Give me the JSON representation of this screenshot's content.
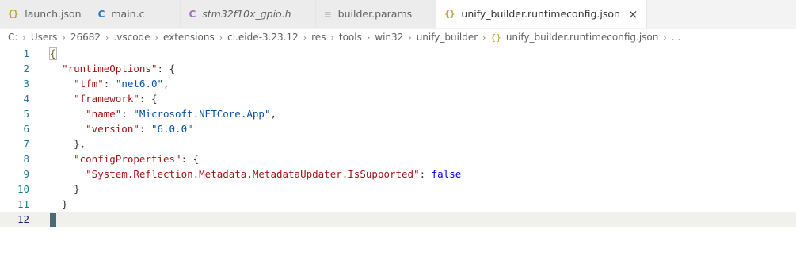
{
  "tabs": [
    {
      "icon": "{}",
      "label": "launch.json",
      "active": false,
      "italic": false
    },
    {
      "icon": "C",
      "label": "main.c",
      "active": false,
      "italic": false
    },
    {
      "icon": "C",
      "label": "stm32f10x_gpio.h",
      "active": false,
      "italic": true
    },
    {
      "icon": "≡",
      "label": "builder.params",
      "active": false,
      "italic": false
    },
    {
      "icon": "{}",
      "label": "unify_builder.runtimeconfig.json",
      "active": true,
      "italic": false,
      "close": "×"
    }
  ],
  "breadcrumb": [
    "C:",
    "Users",
    "26682",
    ".vscode",
    "extensions",
    "cl.eide-3.23.12",
    "res",
    "tools",
    "win32",
    "unify_builder"
  ],
  "breadcrumb_file": {
    "icon": "{}",
    "label": "unify_builder.runtimeconfig.json"
  },
  "breadcrumb_more": "...",
  "editor": {
    "line_numbers": [
      "1",
      "2",
      "3",
      "4",
      "5",
      "6",
      "7",
      "8",
      "9",
      "10",
      "11",
      "12"
    ],
    "lines": [
      "{",
      "  \"runtimeOptions\": {",
      "    \"tfm\": \"net6.0\",",
      "    \"framework\": {",
      "      \"name\": \"Microsoft.NETCore.App\",",
      "      \"version\": \"6.0.0\"",
      "    },",
      "    \"configProperties\": {",
      "      \"System.Reflection.Metadata.MetadataUpdater.IsSupported\": false",
      "    }",
      "  }",
      ""
    ],
    "current_line": 12
  },
  "colors": {
    "key": "#a31515",
    "string": "#0451a5",
    "keyword": "#0000ff",
    "line_number": "#237893"
  }
}
